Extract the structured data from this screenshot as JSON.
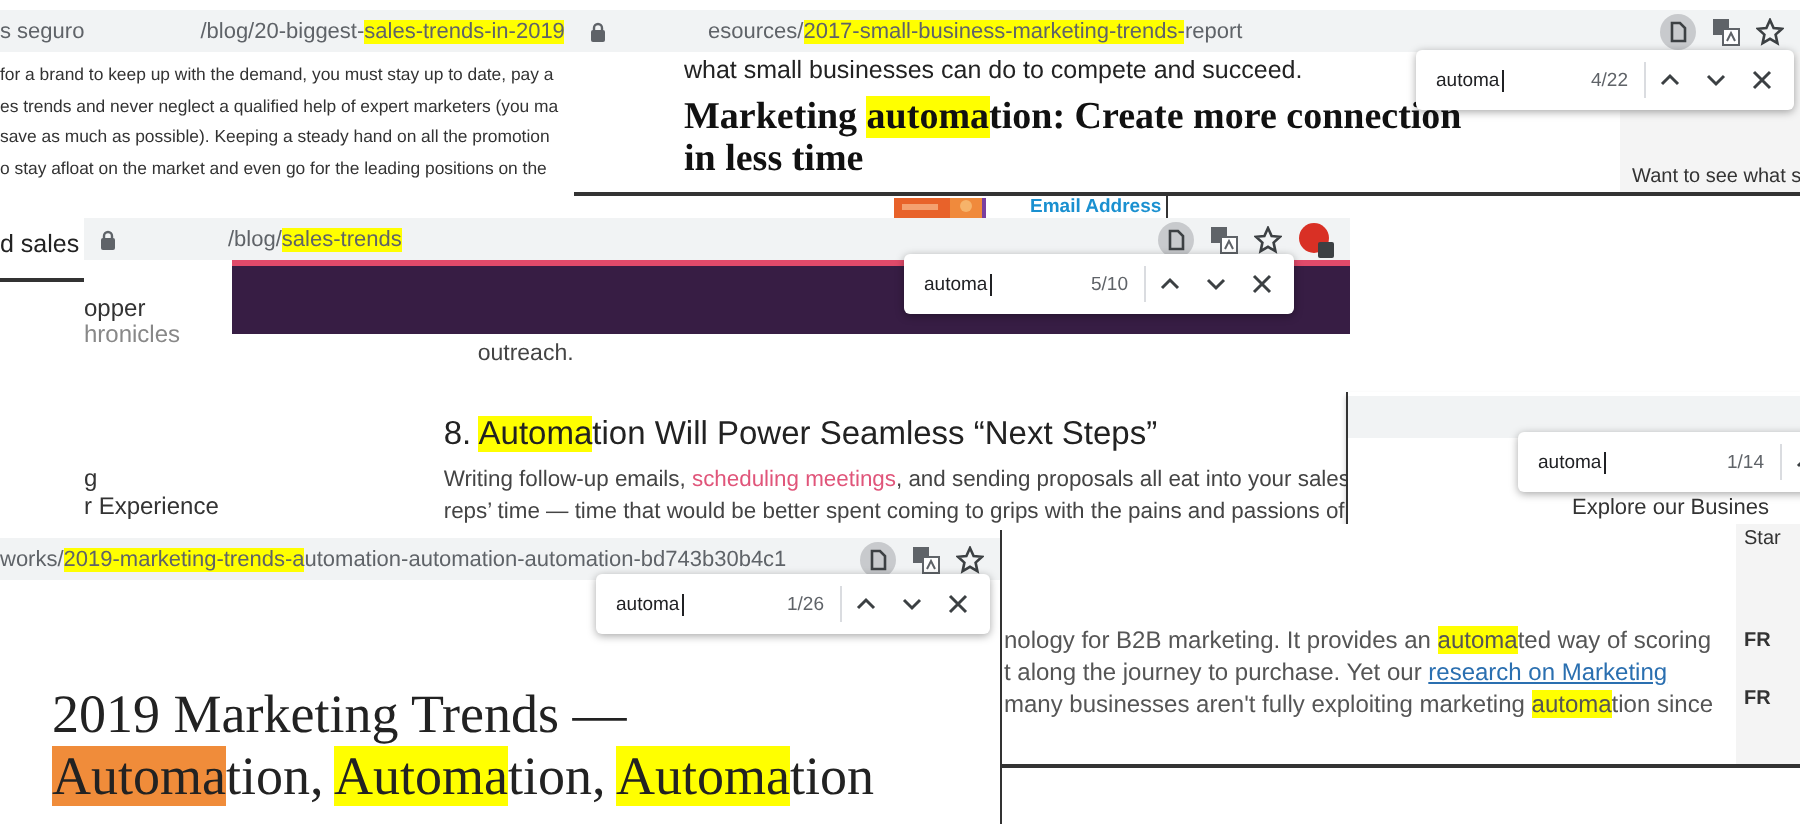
{
  "back_window": {
    "heading": "d sales"
  },
  "sales_2019_window": {
    "security_label": "s seguro",
    "url": [
      {
        "text": "/blog/20-biggest-",
        "kind": "plain"
      },
      {
        "text": "sales-trends-in-2019",
        "kind": "match"
      }
    ],
    "lines": [
      "for a brand to keep up with the demand, you must stay up to date, pay a",
      "es trends and never neglect a qualified help of expert marketers (you ma",
      "save as much as possible). Keeping a steady hand on all the promotion",
      "o stay afloat on the market and even go for the leading positions on the"
    ]
  },
  "signup_strip": {
    "label": "Email Address"
  },
  "small_business_window": {
    "url": [
      {
        "text": "esources/",
        "kind": "plain"
      },
      {
        "text": "2017-small-business-marketing-trends-",
        "kind": "match"
      },
      {
        "text": "report",
        "kind": "plain"
      }
    ],
    "toolbar_icons": [
      {
        "kind": "page"
      },
      {
        "kind": "translate"
      },
      {
        "kind": "star"
      }
    ],
    "find_bar": {
      "query": "automa",
      "count": "4/22",
      "buttons": [
        {
          "kind": "up"
        },
        {
          "kind": "down"
        },
        {
          "kind": "close"
        }
      ]
    },
    "intro": "what small businesses can do to compete and succeed.",
    "heading_lines": [
      [
        {
          "text": "Marketing ",
          "kind": "plain"
        },
        {
          "text": "automa",
          "kind": "match"
        },
        {
          "text": "tion: Create more connection",
          "kind": "plain"
        }
      ],
      [
        {
          "text": "in less time",
          "kind": "plain"
        }
      ]
    ],
    "side_text": "Want to see what s"
  },
  "sales_trends_window": {
    "url": [
      {
        "text": "/blog/",
        "kind": "plain"
      },
      {
        "text": "sales-trends",
        "kind": "match"
      }
    ],
    "toolbar_icons": [
      {
        "kind": "page"
      },
      {
        "kind": "translate"
      },
      {
        "kind": "star"
      },
      {
        "kind": "extension"
      }
    ],
    "find_bar": {
      "query": "automa",
      "count": "5/10",
      "buttons": [
        {
          "kind": "up"
        },
        {
          "kind": "down"
        },
        {
          "kind": "close"
        }
      ]
    },
    "sidebar_items": [
      "opper",
      "hronicles",
      "g",
      "r Experience"
    ],
    "lead": "outreach.",
    "heading": [
      {
        "text": "8. ",
        "kind": "plain"
      },
      {
        "text": "Automa",
        "kind": "match"
      },
      {
        "text": "tion Will Power Seamless “Next Steps”",
        "kind": "plain"
      }
    ],
    "paragraph_lines": [
      [
        {
          "text": "Writing follow-up emails, ",
          "kind": "plain"
        },
        {
          "text": "scheduling meetings",
          "kind": "link"
        },
        {
          "text": ", and sending proposals all eat into your sales",
          "kind": "plain"
        }
      ],
      [
        {
          "text": "reps’ time — time that would be better spent coming to grips with the pains and passions of",
          "kind": "plain"
        }
      ]
    ]
  },
  "services_window": {
    "find_bar": {
      "query": "automa",
      "count": "1/14",
      "buttons": [
        {
          "kind": "up"
        }
      ]
    },
    "text": "Explore our Busines"
  },
  "b2b_window": {
    "side_items": [
      "Star",
      "FR",
      "FR"
    ],
    "lines": [
      [
        {
          "text": "nology for B2B marketing. It provides an ",
          "kind": "plain"
        },
        {
          "text": "automa",
          "kind": "match"
        },
        {
          "text": "ted way of scoring",
          "kind": "plain"
        }
      ],
      [
        {
          "text": "t along the journey to purchase. Yet our ",
          "kind": "plain"
        },
        {
          "text": "research on Marketing",
          "kind": "link"
        }
      ],
      [
        {
          "text": "many businesses aren't fully exploiting marketing ",
          "kind": "plain"
        },
        {
          "text": "automa",
          "kind": "match"
        },
        {
          "text": "tion since",
          "kind": "plain"
        }
      ]
    ]
  },
  "trends_2019_window": {
    "url": [
      {
        "text": "works/",
        "kind": "plain"
      },
      {
        "text": "2019-marketing-trends-a",
        "kind": "match"
      },
      {
        "text": "utomation-automation-automation-bd743b30b4c1",
        "kind": "plain"
      }
    ],
    "toolbar_icons": [
      {
        "kind": "page"
      },
      {
        "kind": "translate"
      },
      {
        "kind": "star"
      }
    ],
    "find_bar": {
      "query": "automa",
      "count": "1/26",
      "buttons": [
        {
          "kind": "up"
        },
        {
          "kind": "down"
        },
        {
          "kind": "close"
        }
      ]
    },
    "title_lines": [
      [
        {
          "text": "2019 Marketing Trends —",
          "kind": "plain"
        }
      ],
      [
        {
          "text": "Automa",
          "kind": "current"
        },
        {
          "text": "tion, ",
          "kind": "plain"
        },
        {
          "text": "Automa",
          "kind": "match"
        },
        {
          "text": "tion, ",
          "kind": "plain"
        },
        {
          "text": "Automa",
          "kind": "match"
        },
        {
          "text": "tion",
          "kind": "plain"
        }
      ]
    ]
  }
}
